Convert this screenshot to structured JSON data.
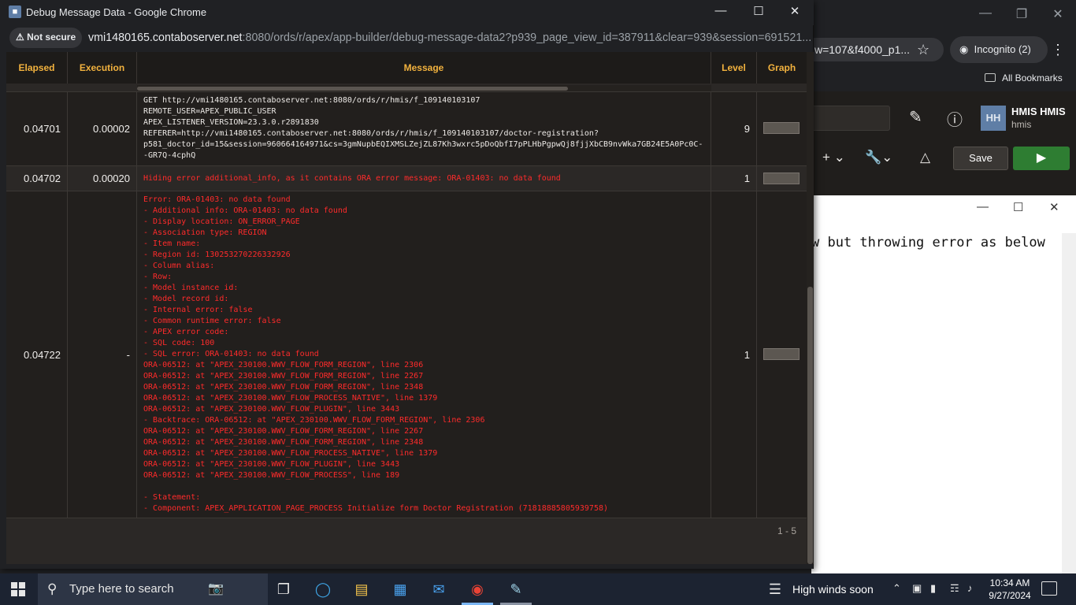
{
  "background_browser": {
    "omnibox_fragment": "w=107&f4000_p1...",
    "incognito_label": "Incognito (2)",
    "bookmarks_label": "All Bookmarks",
    "apex_user_initials": "HH",
    "apex_user_name": "HMIS HMIS",
    "apex_user_id": "hmis",
    "save_label": "Save"
  },
  "notepad": {
    "text": "w but throwing error as below"
  },
  "popup": {
    "title": "Debug Message Data - Google Chrome",
    "not_secure_label": "Not secure",
    "url_host": "vmi1480165.contaboserver.net",
    "url_rest": ":8080/ords/r/apex/app-builder/debug-message-data2?p939_page_view_id=387911&clear=939&session=691521..."
  },
  "report": {
    "columns": [
      "Elapsed",
      "Execution",
      "Message",
      "Level",
      "Graph"
    ],
    "rows": [
      {
        "elapsed": "0.04701",
        "execution": "0.00002",
        "message": "GET http://vmi1480165.contaboserver.net:8080/ords/r/hmis/f_109140103107\nREMOTE_USER=APEX_PUBLIC_USER\nAPEX_LISTENER_VERSION=23.3.0.r2891830\nREFERER=http://vmi1480165.contaboserver.net:8080/ords/r/hmis/f_109140103107/doctor-registration?\np581_doctor_id=15&session=960664164971&cs=3gmNupbEQIXMSLZejZL87Kh3wxrc5pDoQbfI7pPLHbPgpwQj8fjjXbCB9nvWka7GB24E5A0Pc0C-\n-GR7Q-4cphQ",
        "level": "9",
        "graph_fraction": 1
      },
      {
        "elapsed": "0.04702",
        "execution": "0.00020",
        "message": "Hiding error additional_info, as it contains ORA error message: ORA-01403: no data found",
        "level": "1",
        "graph_fraction": 1
      },
      {
        "elapsed": "0.04722",
        "execution": "-",
        "message": "Error: ORA-01403: no data found\n- Additional info: ORA-01403: no data found\n- Display location: ON_ERROR_PAGE\n- Association type: REGION\n- Item name:\n- Region id: 130253270226332926\n- Column alias:\n- Row:\n- Model instance id:\n- Model record id:\n- Internal error: false\n- Common runtime error: false\n- APEX error code:\n- SQL code: 100\n- SQL error: ORA-01403: no data found\nORA-06512: at \"APEX_230100.WWV_FLOW_FORM_REGION\", line 2306\nORA-06512: at \"APEX_230100.WWV_FLOW_FORM_REGION\", line 2267\nORA-06512: at \"APEX_230100.WWV_FLOW_FORM_REGION\", line 2348\nORA-06512: at \"APEX_230100.WWV_FLOW_PROCESS_NATIVE\", line 1379\nORA-06512: at \"APEX_230100.WWV_FLOW_PLUGIN\", line 3443\n- Backtrace: ORA-06512: at \"APEX_230100.WWV_FLOW_FORM_REGION\", line 2306\nORA-06512: at \"APEX_230100.WWV_FLOW_FORM_REGION\", line 2267\nORA-06512: at \"APEX_230100.WWV_FLOW_FORM_REGION\", line 2348\nORA-06512: at \"APEX_230100.WWV_FLOW_PROCESS_NATIVE\", line 1379\nORA-06512: at \"APEX_230100.WWV_FLOW_PLUGIN\", line 3443\nORA-06512: at \"APEX_230100.WWV_FLOW_PROCESS\", line 189\n\n- Statement:\n- Component: APEX_APPLICATION_PAGE_PROCESS Initialize form Doctor Registration (71818885805939758)",
        "level": "1",
        "graph_fraction": 1
      }
    ],
    "pagination": "1 - 5"
  },
  "taskbar": {
    "search_placeholder": "Type here to search",
    "weather": "High winds soon",
    "time": "10:34 AM",
    "date": "9/27/2024"
  }
}
